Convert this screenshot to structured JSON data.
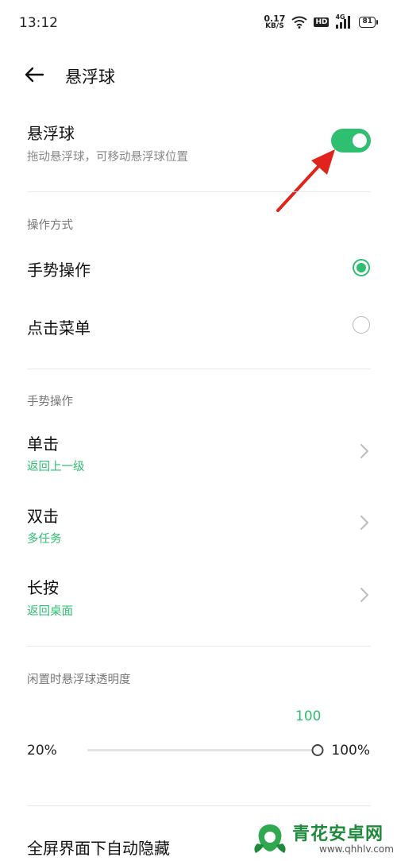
{
  "status_bar": {
    "time": "13:12",
    "net_speed_value": "0.17",
    "net_speed_unit": "KB/S",
    "hd_label": "HD",
    "signal_label": "4G",
    "battery_level": "81",
    "icons": [
      "wifi-icon",
      "signal-icon",
      "battery-icon"
    ]
  },
  "header": {
    "back_icon": "back-arrow-icon",
    "title": "悬浮球"
  },
  "floating_ball": {
    "title": "悬浮球",
    "subtitle": "拖动悬浮球，可移动悬浮球位置",
    "enabled": true
  },
  "operation_mode": {
    "section_label": "操作方式",
    "options": [
      {
        "label": "手势操作",
        "selected": true
      },
      {
        "label": "点击菜单",
        "selected": false
      }
    ]
  },
  "gestures": {
    "section_label": "手势操作",
    "items": [
      {
        "title": "单击",
        "value": "返回上一级"
      },
      {
        "title": "双击",
        "value": "多任务"
      },
      {
        "title": "长按",
        "value": "返回桌面"
      }
    ]
  },
  "opacity": {
    "section_label": "闲置时悬浮球透明度",
    "current_value": "100",
    "min_label": "20%",
    "max_label": "100%",
    "value_fraction": 1.0
  },
  "fullscreen_hide": {
    "title": "全屏界面下自动隐藏"
  },
  "watermark": {
    "brand": "青花安卓网",
    "url": "www.qhhlv.com"
  },
  "colors": {
    "accent": "#2fbf71",
    "annotation_arrow": "#e0241b"
  }
}
